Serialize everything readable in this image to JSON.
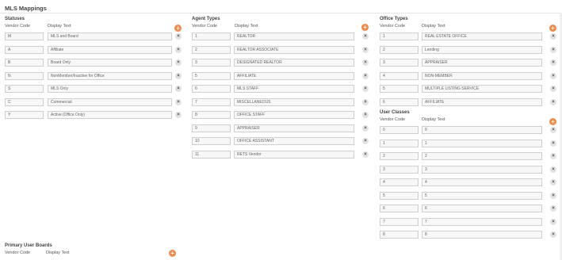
{
  "page": {
    "title": "MLS Mappings"
  },
  "colors": {
    "accent": "#f08a4b",
    "field_bg": "#f7f7f7",
    "field_border": "#cfcfcf"
  },
  "icons": {
    "add": "plus-circle-icon",
    "delete": "x-circle-icon"
  },
  "statuses": {
    "title": "Statuses",
    "vendor_code_header": "Vendor Code",
    "display_text_header": "Display Text",
    "rows": [
      {
        "code": "M",
        "text": "MLS and Board"
      },
      {
        "code": "A",
        "text": "Affiliate"
      },
      {
        "code": "B",
        "text": "Board Only"
      },
      {
        "code": "N",
        "text": "NonMember/Inactive for Office"
      },
      {
        "code": "S",
        "text": "MLS Only"
      },
      {
        "code": "C",
        "text": "Commercial"
      },
      {
        "code": "Y",
        "text": "Active (Office Only)"
      }
    ]
  },
  "agent_types": {
    "title": "Agent Types",
    "vendor_code_header": "Vendor Code",
    "display_text_header": "Display Text",
    "rows": [
      {
        "code": "1",
        "text": "REALTOR"
      },
      {
        "code": "2",
        "text": "REALTOR ASSOCIATE"
      },
      {
        "code": "3",
        "text": "DESIGNATED REALTOR"
      },
      {
        "code": "5",
        "text": "AFFILIATE"
      },
      {
        "code": "6",
        "text": "MLS STAFF"
      },
      {
        "code": "7",
        "text": "MISCELLANEOUS"
      },
      {
        "code": "8",
        "text": "OFFICE STAFF"
      },
      {
        "code": "9",
        "text": "APPRAISER"
      },
      {
        "code": "10",
        "text": "OFFICE ASSISTANT"
      },
      {
        "code": "11",
        "text": "RETS Vendor"
      }
    ]
  },
  "office_types": {
    "title": "Office Types",
    "vendor_code_header": "Vendor Code",
    "display_text_header": "Display Text",
    "rows": [
      {
        "code": "1",
        "text": "REAL ESTATE OFFICE"
      },
      {
        "code": "2",
        "text": "Lending"
      },
      {
        "code": "3",
        "text": "APPRAISER"
      },
      {
        "code": "4",
        "text": "NON-MEMBER"
      },
      {
        "code": "5",
        "text": "MULTIPLE LISTING SERVICE"
      },
      {
        "code": "6",
        "text": "AFFILIATE"
      }
    ]
  },
  "user_classes": {
    "title": "User Classes",
    "vendor_code_header": "Vendor Code",
    "display_text_header": "Display Text",
    "rows": [
      {
        "code": "0",
        "text": "0"
      },
      {
        "code": "1",
        "text": "1"
      },
      {
        "code": "2",
        "text": "2"
      },
      {
        "code": "3",
        "text": "3"
      },
      {
        "code": "4",
        "text": "4"
      },
      {
        "code": "5",
        "text": "5"
      },
      {
        "code": "6",
        "text": "6"
      },
      {
        "code": "7",
        "text": "7"
      },
      {
        "code": "8",
        "text": "8"
      }
    ]
  },
  "primary_user_boards": {
    "title": "Primary User Boards",
    "vendor_code_header": "Vendor Code",
    "display_text_header": "Display Text",
    "rows": []
  }
}
